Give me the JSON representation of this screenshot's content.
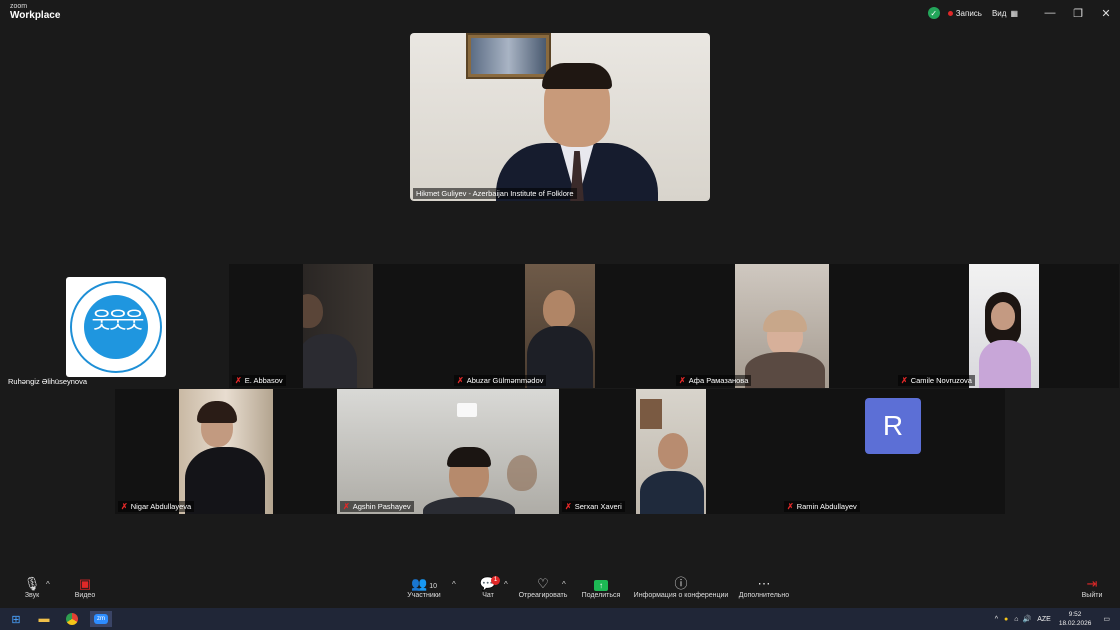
{
  "titlebar": {
    "brand_small": "zoom",
    "brand_big": "Workplace",
    "recording_label": "Запись",
    "view_label": "Вид",
    "minimize": "—",
    "restore": "❐",
    "close": "✕"
  },
  "speaker": {
    "name": "Hikmet Guliyev - Azerbaijan Institute of Folklore"
  },
  "participants": {
    "ruhengiz": "Ruhəngiz Əlihüseynova",
    "abbasov": "E. Abbasov",
    "abuzar": "Abuzar Gülməmmədov",
    "afa": "Афа Рамазанова",
    "camile": "Camile Novruzova",
    "nigar": "Nigar Abdullayeva",
    "agshin": "Agshin Pashayev",
    "serxan": "Serxan Xaveri",
    "ramin": "Ramin Abdullayev",
    "ramin_initial": "R"
  },
  "toolbar": {
    "audio": "Звук",
    "video": "Видео",
    "participants": "Участники",
    "participants_count": "10",
    "chat": "Чат",
    "chat_badge": "1",
    "react": "Отреагировать",
    "share": "Поделиться",
    "info": "Информация о конференции",
    "more": "Дополнительно",
    "leave": "Выйти"
  },
  "taskbar": {
    "lang": "AZE",
    "time": "9:52",
    "date": "18.02.2026"
  }
}
